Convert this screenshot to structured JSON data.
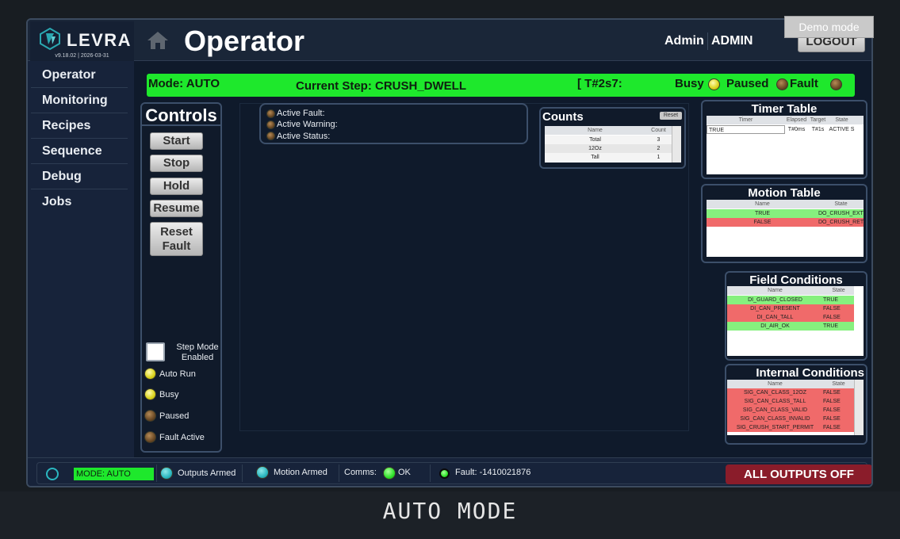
{
  "header": {
    "logo": "LEVRA",
    "version": "v9.18.02 | 2026-03-31",
    "title": "Operator",
    "user_role": "Admin",
    "user_name": "ADMIN",
    "logout_label": "LOGOUT",
    "demo_mode_label": "Demo mode"
  },
  "sidebar": {
    "items": [
      {
        "label": "Operator"
      },
      {
        "label": "Monitoring"
      },
      {
        "label": "Recipes"
      },
      {
        "label": "Sequence"
      },
      {
        "label": "Debug"
      },
      {
        "label": "Jobs"
      }
    ]
  },
  "status_bar": {
    "mode": "Mode: AUTO",
    "current_step": "Current Step: CRUSH_DWELL",
    "timer": "[ T#2s7:",
    "busy": "Busy",
    "paused": "Paused",
    "fault": "Fault",
    "colors": {
      "bar": "#1ee82c"
    }
  },
  "controls": {
    "title": "Controls",
    "buttons": {
      "start": "Start",
      "stop": "Stop",
      "hold": "Hold",
      "resume": "Resume",
      "reset_line1": "Reset",
      "reset_line2": "Fault"
    },
    "step_mode_line1": "Step Mode",
    "step_mode_line2": "Enabled",
    "indicators": {
      "auto_run": "Auto Run",
      "busy": "Busy",
      "paused": "Paused",
      "fault_active": "Fault Active"
    }
  },
  "messages": {
    "active_fault": "Active Fault:",
    "active_warning": "Active Warning:",
    "active_status": "Active Status:"
  },
  "counts": {
    "title": "Counts",
    "reset": "Reset",
    "columns": [
      "Name",
      "Count"
    ],
    "rows": [
      {
        "name": "Total",
        "count": "3"
      },
      {
        "name": "12Oz",
        "count": "2"
      },
      {
        "name": "Tall",
        "count": "1"
      }
    ]
  },
  "timer_table": {
    "title": "Timer Table",
    "columns": [
      "Timer",
      "Elapsed",
      "Target",
      "State"
    ],
    "rows": [
      {
        "timer": "TRUE",
        "elapsed": "T#0ms",
        "target": "T#1s",
        "state": "ACTIVE S"
      }
    ]
  },
  "motion_table": {
    "title": "Motion Table",
    "columns": [
      "Name",
      "State"
    ],
    "rows": [
      {
        "name": "TRUE",
        "state": "DO_CRUSH_EXT",
        "status": "green"
      },
      {
        "name": "FALSE",
        "state": "DO_CRUSH_RET",
        "status": "red"
      }
    ]
  },
  "field_conditions": {
    "title": "Field Conditions",
    "columns": [
      "Name",
      "State"
    ],
    "rows": [
      {
        "name": "DI_GUARD_CLOSED",
        "state": "TRUE",
        "status": "green"
      },
      {
        "name": "DI_CAN_PRESENT",
        "state": "FALSE",
        "status": "red"
      },
      {
        "name": "DI_CAN_TALL",
        "state": "FALSE",
        "status": "red"
      },
      {
        "name": "DI_AIR_OK",
        "state": "TRUE",
        "status": "green"
      }
    ]
  },
  "internal_conditions": {
    "title": "Internal Conditions",
    "columns": [
      "Name",
      "State"
    ],
    "rows": [
      {
        "name": "SIG_CAN_CLASS_12OZ",
        "state": "FALSE",
        "status": "red"
      },
      {
        "name": "SIG_CAN_CLASS_TALL",
        "state": "FALSE",
        "status": "red"
      },
      {
        "name": "SIG_CAN_CLASS_VALID",
        "state": "FALSE",
        "status": "red"
      },
      {
        "name": "SIG_CAN_CLASS_INVALID",
        "state": "FALSE",
        "status": "red"
      },
      {
        "name": "SIG_CRUSH_START_PERMIT",
        "state": "FALSE",
        "status": "red"
      }
    ]
  },
  "footer": {
    "mode": "MODE: AUTO",
    "outputs_armed": "Outputs Armed",
    "motion_armed": "Motion Armed",
    "comms_label": "Comms:",
    "comms_value": "OK",
    "fault": "Fault: -1410021876",
    "all_outputs_off": "ALL OUTPUTS OFF"
  },
  "caption": "AUTO MODE"
}
